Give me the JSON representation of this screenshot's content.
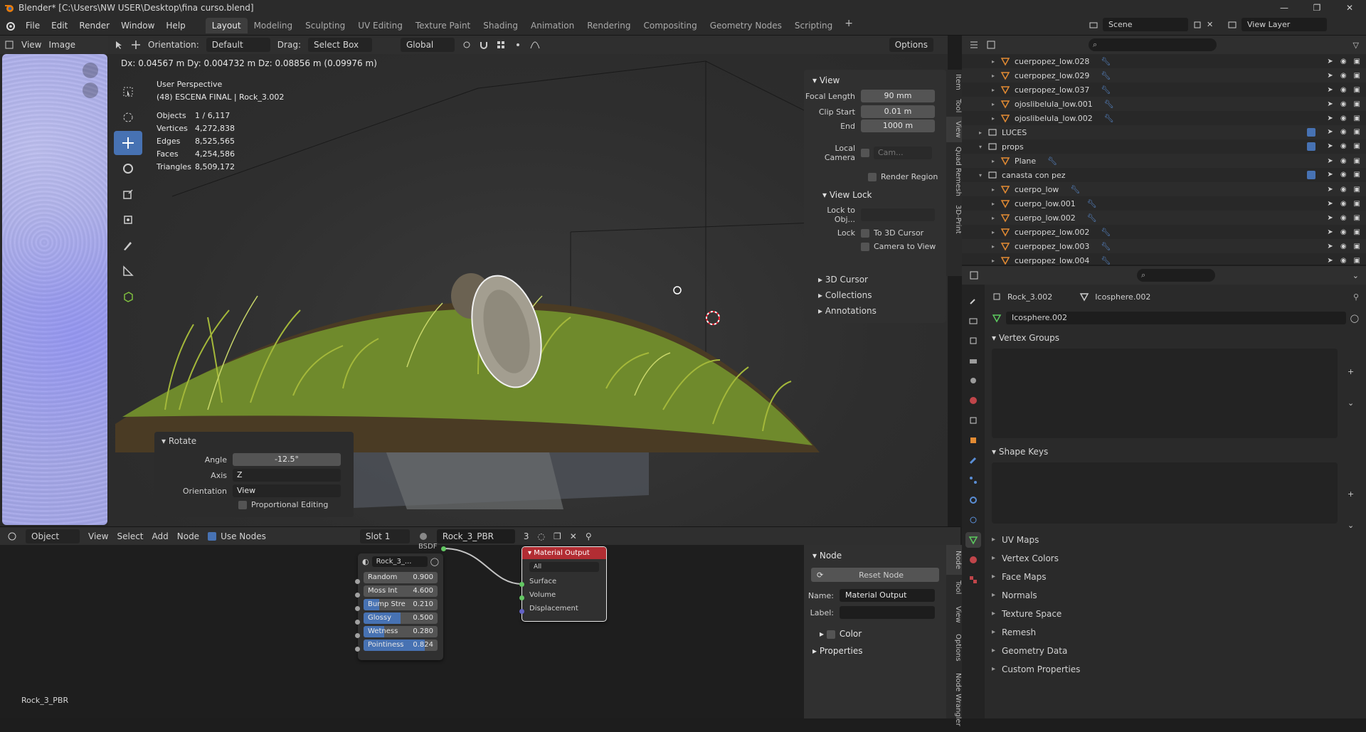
{
  "titlebar": {
    "title": "Blender* [C:\\Users\\NW  USER\\Desktop\\fina curso.blend]"
  },
  "menu": [
    "File",
    "Edit",
    "Render",
    "Window",
    "Help"
  ],
  "workspaces": [
    "Layout",
    "Modeling",
    "Sculpting",
    "UV Editing",
    "Texture Paint",
    "Shading",
    "Animation",
    "Rendering",
    "Compositing",
    "Geometry Nodes",
    "Scripting"
  ],
  "active_workspace": "Layout",
  "scene": {
    "name": "Scene",
    "view_layer": "View Layer"
  },
  "image_editor": {
    "view": "View",
    "image": "Image"
  },
  "viewport_header": {
    "orientation_label": "Orientation:",
    "orientation_value": "Default",
    "drag_label": "Drag:",
    "drag_value": "Select Box",
    "transform_orientation": "Global",
    "options": "Options"
  },
  "viewport": {
    "delta": "Dx: 0.04567 m   Dy: 0.004732 m   Dz: 0.08856 m (0.09976 m)",
    "perspective": "User Perspective",
    "collection": "(48) ESCENA FINAL | Rock_3.002",
    "stats": [
      {
        "k": "Objects",
        "v": "1 / 6,117"
      },
      {
        "k": "Vertices",
        "v": "4,272,838"
      },
      {
        "k": "Edges",
        "v": "8,525,565"
      },
      {
        "k": "Faces",
        "v": "4,254,586"
      },
      {
        "k": "Triangles",
        "v": "8,509,172"
      }
    ]
  },
  "npanel": {
    "view_title": "View",
    "focal_length_label": "Focal Length",
    "focal_length": "90 mm",
    "clip_start_label": "Clip Start",
    "clip_start": "0.01 m",
    "end_label": "End",
    "end": "1000 m",
    "local_camera_label": "Local Camera",
    "local_camera_value": "Cam...",
    "render_region": "Render Region",
    "view_lock_title": "View Lock",
    "lock_to_obj_label": "Lock to Obj...",
    "lock_label": "Lock",
    "to_3d_cursor": "To 3D Cursor",
    "camera_to_view": "Camera to View",
    "collapsed": [
      "3D Cursor",
      "Collections",
      "Annotations"
    ],
    "tabs": [
      "Item",
      "Tool",
      "View",
      "Quad Remesh",
      "3D-Print"
    ]
  },
  "rotate_panel": {
    "title": "Rotate",
    "angle_label": "Angle",
    "angle": "-12.5°",
    "axis_label": "Axis",
    "axis": "Z",
    "orientation_label": "Orientation",
    "orientation": "View",
    "proportional": "Proportional Editing"
  },
  "node_header": {
    "mode": "Object",
    "menus": [
      "View",
      "Select",
      "Add",
      "Node"
    ],
    "use_nodes": "Use Nodes",
    "slot": "Slot 1",
    "material": "Rock_3_PBR",
    "users": "3"
  },
  "node_group": {
    "out_label": "BSDF",
    "name": "Rock_3_...",
    "sliders": [
      {
        "label": "Random",
        "value": "0.900",
        "fill": 0
      },
      {
        "label": "Moss Int",
        "value": "4.600",
        "fill": 0
      },
      {
        "label": "Bump Stre",
        "value": "0.210",
        "fill": 0.21
      },
      {
        "label": "Glossy",
        "value": "0.500",
        "fill": 0.5
      },
      {
        "label": "Wetness",
        "value": "0.280",
        "fill": 0.28
      },
      {
        "label": "Pointiness",
        "value": "0.824",
        "fill": 0.824
      }
    ]
  },
  "material_output": {
    "title": "Material Output",
    "target": "All",
    "inputs": [
      "Surface",
      "Volume",
      "Displacement"
    ]
  },
  "node_canvas_label": "Rock_3_PBR",
  "node_panel": {
    "title": "Node",
    "reset": "Reset Node",
    "name_label": "Name:",
    "name": "Material Output",
    "label_label": "Label:",
    "color": "Color",
    "properties": "Properties",
    "tabs": [
      "Node",
      "Tool",
      "View",
      "Options",
      "Node Wrangler"
    ]
  },
  "outliner": {
    "rows": [
      {
        "name": "cuerpopez_low.028",
        "indent": 2,
        "type": "mesh"
      },
      {
        "name": "cuerpopez_low.029",
        "indent": 2,
        "type": "mesh"
      },
      {
        "name": "cuerpopez_low.037",
        "indent": 2,
        "type": "mesh"
      },
      {
        "name": "ojoslibelula_low.001",
        "indent": 2,
        "type": "mesh"
      },
      {
        "name": "ojoslibelula_low.002",
        "indent": 2,
        "type": "mesh"
      },
      {
        "name": "LUCES",
        "indent": 1,
        "type": "collection"
      },
      {
        "name": "props",
        "indent": 1,
        "type": "collection"
      },
      {
        "name": "Plane",
        "indent": 2,
        "type": "mesh"
      },
      {
        "name": "canasta con pez",
        "indent": 1,
        "type": "collection"
      },
      {
        "name": "cuerpo_low",
        "indent": 2,
        "type": "mesh"
      },
      {
        "name": "cuerpo_low.001",
        "indent": 2,
        "type": "mesh"
      },
      {
        "name": "cuerpo_low.002",
        "indent": 2,
        "type": "mesh"
      },
      {
        "name": "cuerpopez_low.002",
        "indent": 2,
        "type": "mesh"
      },
      {
        "name": "cuerpopez_low.003",
        "indent": 2,
        "type": "mesh"
      },
      {
        "name": "cuerpopez_low.004",
        "indent": 2,
        "type": "mesh"
      }
    ]
  },
  "properties": {
    "object": "Rock_3.002",
    "mesh": "Icosphere.002",
    "mesh_field": "Icosphere.002",
    "vertex_groups": "Vertex Groups",
    "shape_keys": "Shape Keys",
    "subsections": [
      "UV Maps",
      "Vertex Colors",
      "Face Maps",
      "Normals",
      "Texture Space",
      "Remesh",
      "Geometry Data",
      "Custom Properties"
    ]
  },
  "colors": {
    "accent": "#4772b3",
    "header": "#2f2f2f",
    "panel": "#303030",
    "node_output": "#b22d33"
  }
}
